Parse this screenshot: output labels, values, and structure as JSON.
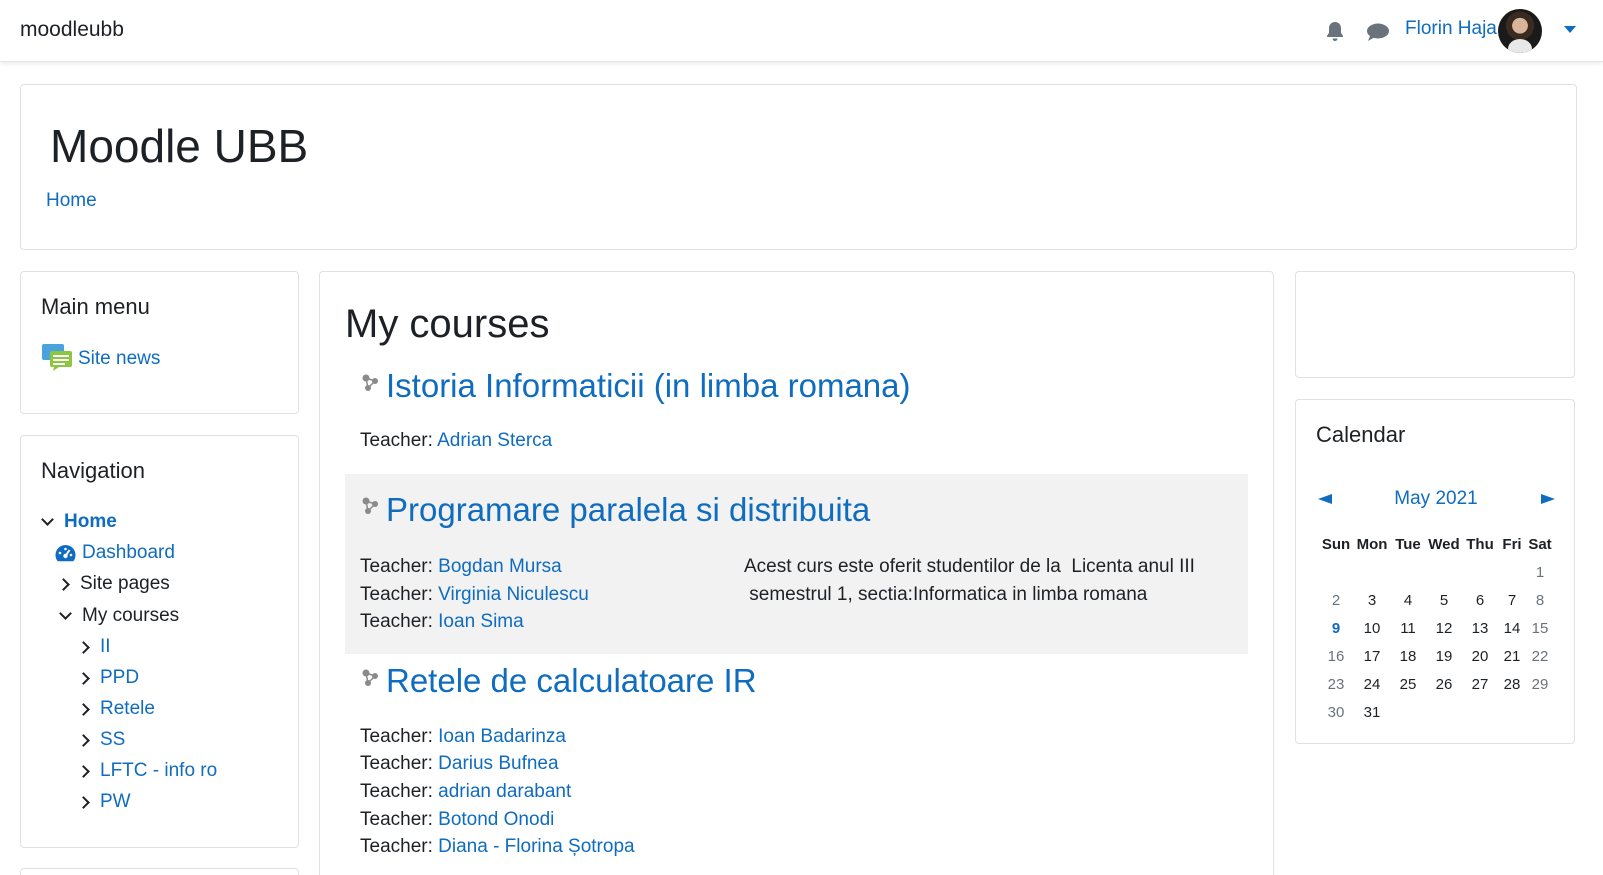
{
  "navbar": {
    "brand": "moodleubb",
    "username": "Florin Haja",
    "icons": [
      "bell-icon",
      "chat-icon"
    ]
  },
  "header": {
    "site_title": "Moodle UBB",
    "breadcrumb": "Home"
  },
  "main_menu": {
    "title": "Main menu",
    "items": [
      {
        "label": "Site news",
        "icon": "site-news-icon"
      }
    ]
  },
  "navigation": {
    "title": "Navigation",
    "items": {
      "home": "Home",
      "dashboard": "Dashboard",
      "site_pages": "Site pages",
      "my_courses": "My courses",
      "courses": [
        "II",
        "PPD",
        "Retele",
        "SS",
        "LFTC - info ro",
        "PW"
      ]
    }
  },
  "main": {
    "heading": "My courses",
    "teacher_prefix": "Teacher: ",
    "courses": [
      {
        "title": "Istoria Informaticii (in limba romana)",
        "teachers": [
          "Adrian Sterca"
        ],
        "summary": ""
      },
      {
        "title": "Programare paralela si distribuita",
        "teachers": [
          "Bogdan Mursa",
          "Virginia Niculescu",
          "Ioan Sima"
        ],
        "summary_line1": "Acest curs este oferit studentilor de la  Licenta anul III",
        "summary_line2": " semestrul 1, sectia:Informatica in limba romana"
      },
      {
        "title": "Retele de calculatoare IR",
        "teachers": [
          "Ioan Badarinza",
          "Darius Bufnea",
          "adrian darabant",
          "Botond Onodi",
          "Diana - Florina Șotropa"
        ],
        "summary": ""
      }
    ]
  },
  "calendar": {
    "title": "Calendar",
    "month": "May 2021",
    "weekdays": [
      "Sun",
      "Mon",
      "Tue",
      "Wed",
      "Thu",
      "Fri",
      "Sat"
    ],
    "today": "9",
    "weeks": [
      [
        "",
        "",
        "",
        "",
        "",
        "",
        "1"
      ],
      [
        "2",
        "3",
        "4",
        "5",
        "6",
        "7",
        "8"
      ],
      [
        "9",
        "10",
        "11",
        "12",
        "13",
        "14",
        "15"
      ],
      [
        "16",
        "17",
        "18",
        "19",
        "20",
        "21",
        "22"
      ],
      [
        "23",
        "24",
        "25",
        "26",
        "27",
        "28",
        "29"
      ],
      [
        "30",
        "31",
        "",
        "",
        "",
        "",
        ""
      ]
    ]
  },
  "colors": {
    "link": "#0f6cbf",
    "shaded": "#f2f2f2",
    "border": "#dee2e6"
  }
}
